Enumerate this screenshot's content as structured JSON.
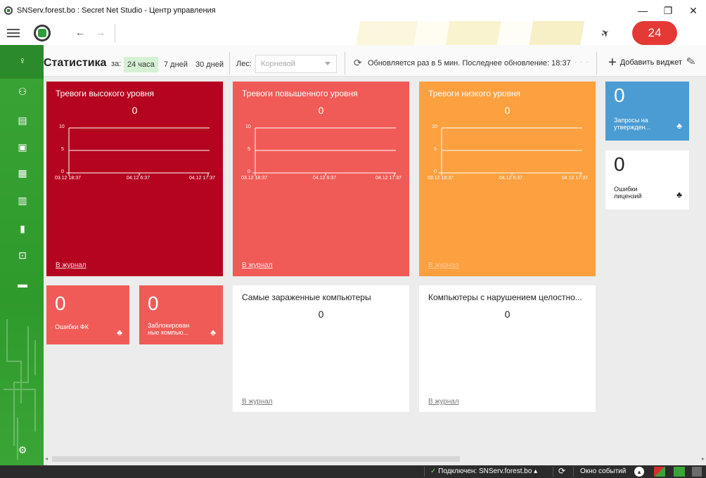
{
  "window": {
    "title": "SNServ.forest.bo : Secret Net Studio - Центр управления",
    "minimize": "—",
    "maximize": "❐",
    "close": "✕"
  },
  "toolbar": {
    "back_icon": "arrow-left-icon",
    "back": "←",
    "forward": "→",
    "pin": "📌",
    "notifications_count": "24"
  },
  "header": {
    "title": "Статистика",
    "period_prefix": "за:",
    "periods": [
      "24 часа",
      "7 дней",
      "30 дней"
    ],
    "active_period": "24 часа",
    "forest_label": "Лес:",
    "forest_value": "Корневой",
    "refresh_icon": "refresh-icon",
    "update_text": "Обновляется раз в 5 мин. Последнее обновление: 18:37",
    "more": "· · ·",
    "add_widget": "Добавить виджет",
    "plus": "+",
    "edit_icon": "pencil-icon"
  },
  "colors": {
    "high": "#b5041f",
    "elevated": "#f05b57",
    "low": "#fda03f",
    "blue": "#4a9cd3",
    "sidebar": "#3aa536"
  },
  "tiles": {
    "high": {
      "title": "Тревоги высокого уровня",
      "count": "0",
      "link": "В журнал"
    },
    "elevated": {
      "title": "Тревоги повышенного уровня",
      "count": "0",
      "link": "В журнал"
    },
    "low": {
      "title": "Тревоги низкого уровня",
      "count": "0",
      "link": "В журнал"
    },
    "infected": {
      "title": "Самые зараженные компьютеры",
      "count": "0",
      "link": "В журнал"
    },
    "integrity": {
      "title": "Компьютеры с нарушением целостно...",
      "count": "0",
      "link": "В журнал"
    }
  },
  "chart_axis": {
    "y_ticks": [
      "10",
      "5",
      "0"
    ],
    "x_ticks": [
      "03.12 18:37",
      "04.12 6:37",
      "04.12 17:37"
    ]
  },
  "small_tiles": {
    "requests": {
      "count": "0",
      "label_1": "Запросы на",
      "label_2": "утвержден..."
    },
    "license": {
      "count": "0",
      "label_1": "Ошибки",
      "label_2": "лицензий"
    },
    "fk": {
      "count": "0",
      "label_1": "Ошибки ФК",
      "label_2": ""
    },
    "blocked": {
      "count": "0",
      "label_1": "Заблокирован",
      "label_2": "ные компью..."
    }
  },
  "statusbar": {
    "connected": "Подключен: SNServ.forest.bo",
    "check": "✓",
    "events": "Окно событий"
  }
}
